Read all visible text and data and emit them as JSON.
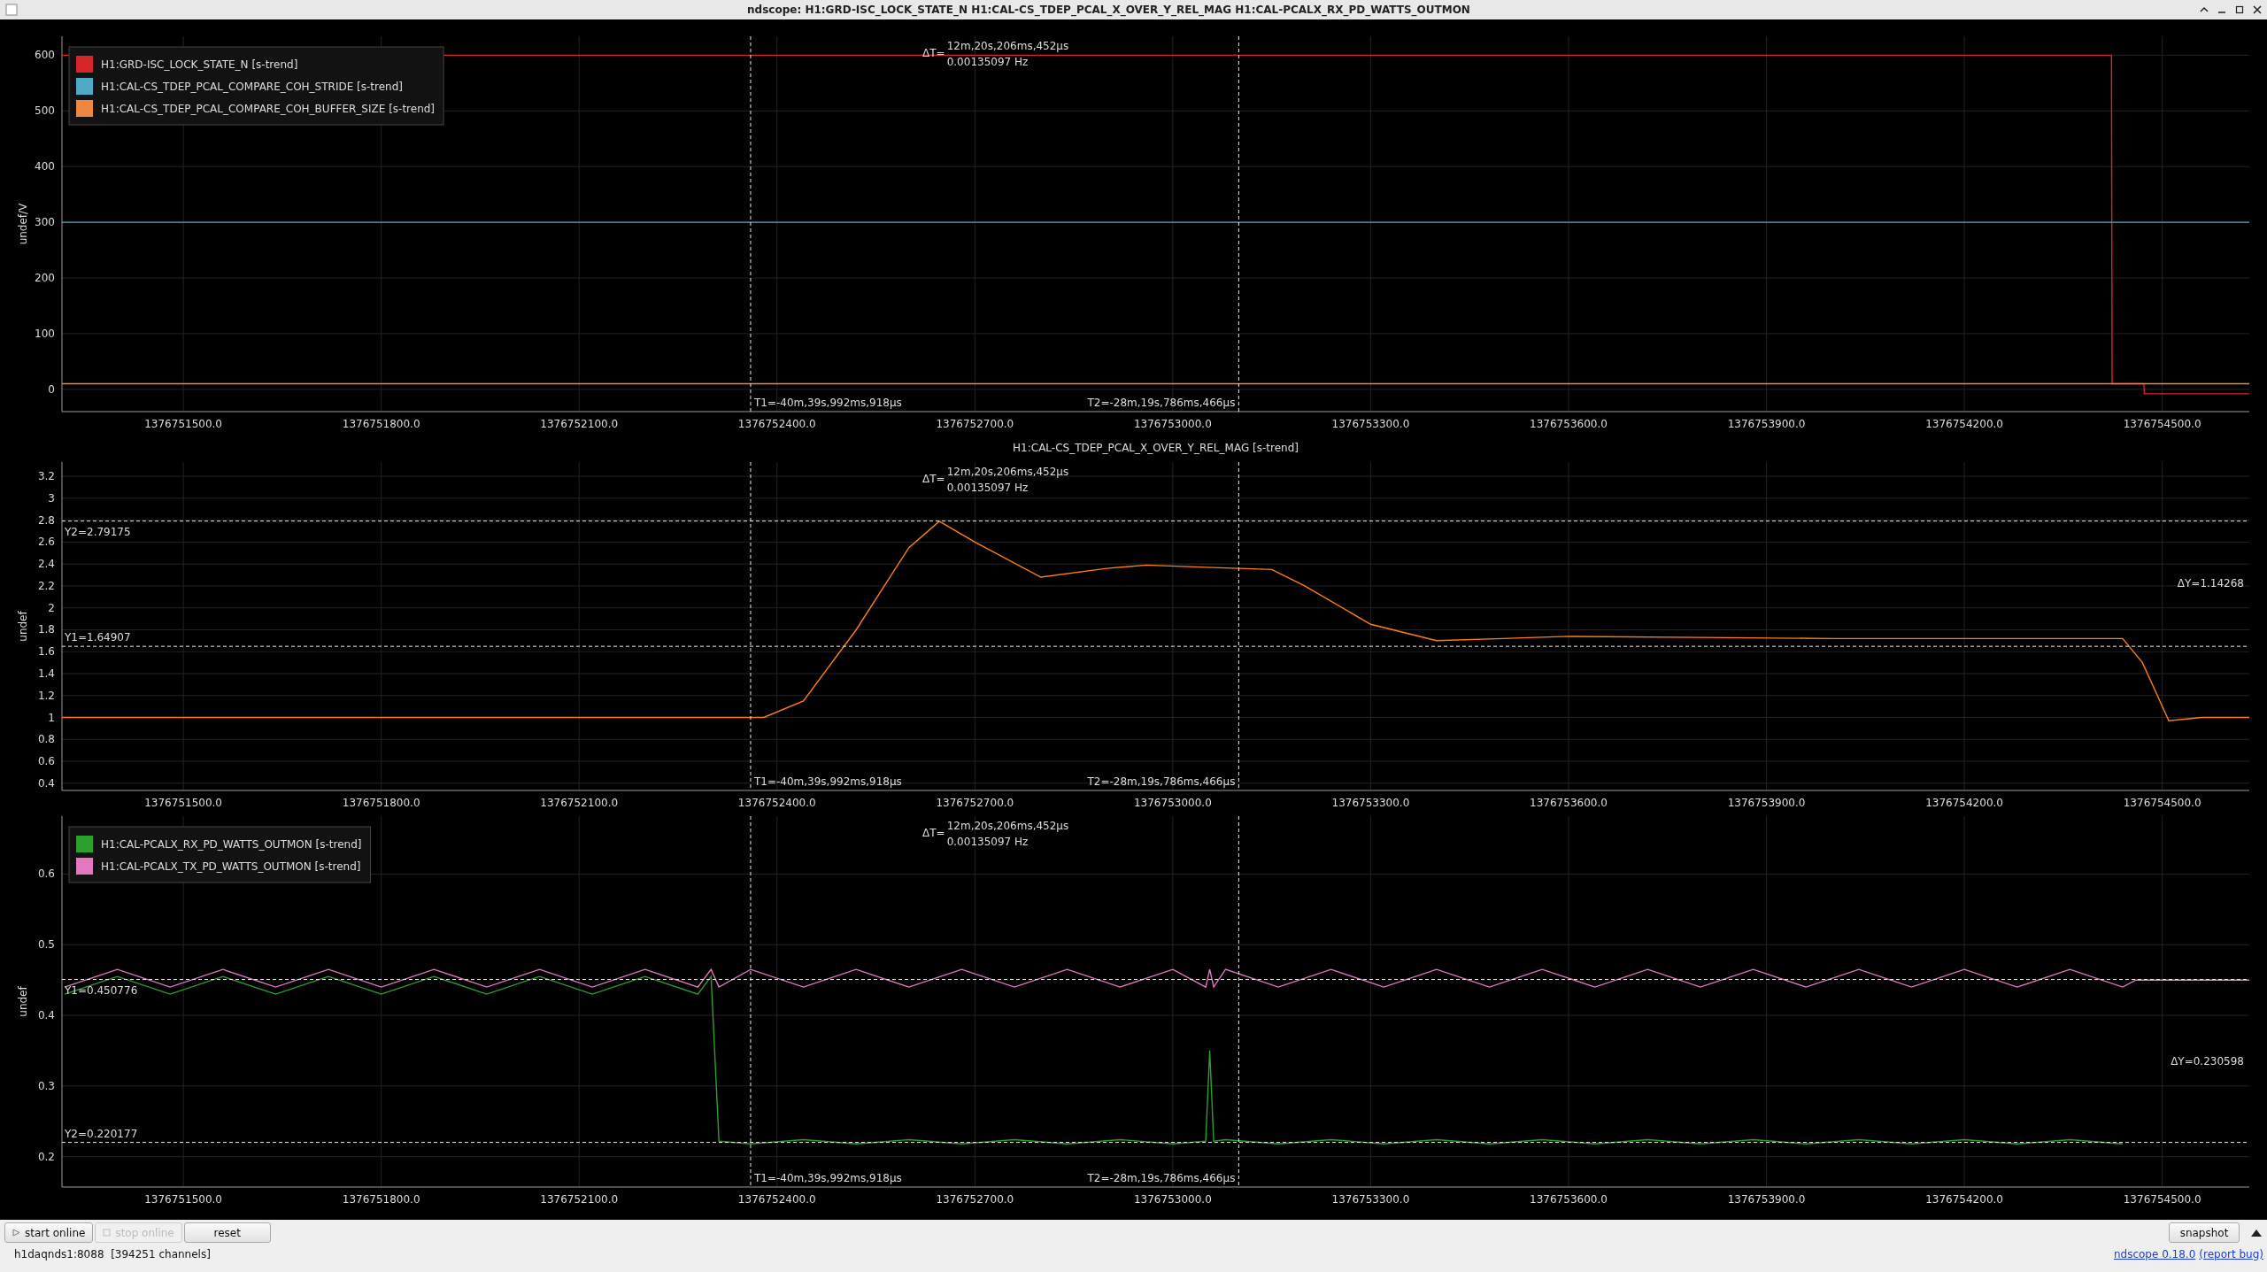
{
  "window": {
    "title": "ndscope: H1:GRD-ISC_LOCK_STATE_N H1:CAL-CS_TDEP_PCAL_X_OVER_Y_REL_MAG H1:CAL-PCALX_RX_PD_WATTS_OUTMON"
  },
  "plots": [
    {
      "cursors": {
        "x_labels": [
          "T1=-40m,39s,992ms,918μs",
          "T2=-28m,19s,786ms,466μs"
        ],
        "delta_x": {
          "label": "ΔT=",
          "value": "12m,20s,206ms,452μs",
          "freq": "0.00135097 Hz"
        }
      },
      "chart_data": {
        "type": "line",
        "ylabel": "undef/V",
        "legend": "upper left",
        "grid": true,
        "x": [
          1376751316,
          1376754423,
          1376754424,
          1376754472,
          1376754473,
          1376754632
        ],
        "series": [
          {
            "name": "H1:GRD-ISC_LOCK_STATE_N [s-trend]",
            "color": "#d62728",
            "values": [
              600,
              600,
              10,
              10,
              -8,
              -8
            ]
          },
          {
            "name": "H1:CAL-CS_TDEP_PCAL_COMPARE_COH_STRIDE [s-trend]",
            "color": "#4fa8c5",
            "values": [
              300,
              300,
              300,
              300,
              300,
              300
            ]
          },
          {
            "name": "H1:CAL-CS_TDEP_PCAL_COMPARE_COH_BUFFER_SIZE [s-trend]",
            "color": "#ef8741",
            "values": [
              10,
              10,
              10,
              10,
              10,
              10
            ]
          }
        ],
        "xlim": [
          1376751316,
          1376754632
        ],
        "ylim": [
          -40,
          634
        ],
        "xticks": [
          {
            "value": 1376751500,
            "label": "1376751500.0"
          },
          {
            "value": 1376751800,
            "label": "1376751800.0"
          },
          {
            "value": 1376752100,
            "label": "1376752100.0"
          },
          {
            "value": 1376752400,
            "label": "1376752400.0"
          },
          {
            "value": 1376752700,
            "label": "1376752700.0"
          },
          {
            "value": 1376753000,
            "label": "1376753000.0"
          },
          {
            "value": 1376753300,
            "label": "1376753300.0"
          },
          {
            "value": 1376753600,
            "label": "1376753600.0"
          },
          {
            "value": 1376753900,
            "label": "1376753900.0"
          },
          {
            "value": 1376754200,
            "label": "1376754200.0"
          },
          {
            "value": 1376754500,
            "label": "1376754500.0"
          }
        ],
        "yticks": [
          0,
          100,
          200,
          300,
          400,
          500,
          600
        ],
        "ref_lines": [
          {
            "axis": "x",
            "value": 1376752360
          },
          {
            "axis": "x",
            "value": 1376753100
          }
        ]
      }
    },
    {
      "cursors": {
        "x_labels": [
          "T1=-40m,39s,992ms,918μs",
          "T2=-28m,19s,786ms,466μs"
        ],
        "delta_x": {
          "label": "ΔT=",
          "value": "12m,20s,206ms,452μs",
          "freq": "0.00135097 Hz"
        },
        "y_labels": [
          "Y2=2.79175",
          "Y1=1.64907"
        ],
        "delta_y": "ΔY=1.14268"
      },
      "chart_data": {
        "type": "line",
        "ylabel": "undef",
        "grid": true,
        "x": [
          1376751316,
          1376752380,
          1376752440,
          1376752520,
          1376752600,
          1376752646,
          1376752700,
          1376752800,
          1376752900,
          1376752960,
          1376753050,
          1376753150,
          1376753200,
          1376753300,
          1376753400,
          1376753500,
          1376753600,
          1376753800,
          1376754000,
          1376754440,
          1376754470,
          1376754510,
          1376754560,
          1376754632
        ],
        "series": [
          {
            "name": "H1:CAL-CS_TDEP_PCAL_X_OVER_Y_REL_MAG [s-trend]",
            "color": "#ff7f0e",
            "values": [
              1,
              1,
              1.15,
              1.8,
              2.55,
              2.79,
              2.6,
              2.28,
              2.36,
              2.39,
              2.37,
              2.35,
              2.2,
              1.85,
              1.7,
              1.72,
              1.74,
              1.73,
              1.72,
              1.72,
              1.5,
              0.97,
              1.0,
              1.0
            ]
          }
        ],
        "xlim": [
          1376751316,
          1376754632
        ],
        "ylim": [
          0.334,
          3.33
        ],
        "xticks": [
          {
            "value": 1376751500,
            "label": "1376751500.0"
          },
          {
            "value": 1376751800,
            "label": "1376751800.0"
          },
          {
            "value": 1376752100,
            "label": "1376752100.0"
          },
          {
            "value": 1376752400,
            "label": "1376752400.0"
          },
          {
            "value": 1376752700,
            "label": "1376752700.0"
          },
          {
            "value": 1376753000,
            "label": "1376753000.0"
          },
          {
            "value": 1376753300,
            "label": "1376753300.0"
          },
          {
            "value": 1376753600,
            "label": "1376753600.0"
          },
          {
            "value": 1376753900,
            "label": "1376753900.0"
          },
          {
            "value": 1376754200,
            "label": "1376754200.0"
          },
          {
            "value": 1376754500,
            "label": "1376754500.0"
          }
        ],
        "yticks": [
          0.4,
          0.6,
          0.8,
          1,
          1.2,
          1.4,
          1.6,
          1.8,
          2,
          2.2,
          2.4,
          2.6,
          2.8,
          3,
          3.2
        ],
        "ref_lines": [
          {
            "axis": "x",
            "value": 1376752360
          },
          {
            "axis": "x",
            "value": 1376753100
          },
          {
            "axis": "y",
            "value": 2.79175
          },
          {
            "axis": "y",
            "value": 1.64907
          }
        ]
      }
    },
    {
      "cursors": {
        "x_labels": [
          "T1=-40m,39s,992ms,918μs",
          "T2=-28m,19s,786ms,466μs"
        ],
        "delta_x": {
          "label": "ΔT=",
          "value": "12m,20s,206ms,452μs",
          "freq": "0.00135097 Hz"
        },
        "y_labels": [
          "Y1=0.450776",
          "Y2=0.220177"
        ],
        "delta_y": "ΔY=0.230598"
      },
      "chart_data": {
        "type": "line",
        "ylabel": "undef",
        "legend": "upper left",
        "grid": true,
        "x": [
          1376751320,
          1376751400,
          1376751480,
          1376751560,
          1376751640,
          1376751720,
          1376751800,
          1376751880,
          1376751960,
          1376752040,
          1376752120,
          1376752200,
          1376752280,
          1376752300,
          1376752312,
          1376752360,
          1376752440,
          1376752520,
          1376752600,
          1376752680,
          1376752760,
          1376752840,
          1376752920,
          1376753000,
          1376753050,
          1376753056,
          1376753062,
          1376753080,
          1376753160,
          1376753240,
          1376753320,
          1376753400,
          1376753480,
          1376753560,
          1376753640,
          1376753720,
          1376753800,
          1376753880,
          1376753960,
          1376754040,
          1376754120,
          1376754200,
          1376754280,
          1376754360,
          1376754440,
          1376754460,
          1376754632
        ],
        "series": [
          {
            "name": "H1:CAL-PCALX_RX_PD_WATTS_OUTMON [s-trend]",
            "color": "#2ca02c",
            "values": [
              0.43,
              0.455,
              0.43,
              0.455,
              0.43,
              0.455,
              0.43,
              0.455,
              0.43,
              0.455,
              0.43,
              0.455,
              0.43,
              0.455,
              0.222,
              0.218,
              0.224,
              0.218,
              0.224,
              0.218,
              0.224,
              0.218,
              0.224,
              0.218,
              0.222,
              0.35,
              0.222,
              0.224,
              0.218,
              0.224,
              0.218,
              0.224,
              0.218,
              0.224,
              0.218,
              0.224,
              0.218,
              0.224,
              0.218,
              0.224,
              0.218,
              0.224,
              0.218,
              0.224,
              0.218,
              null,
              null
            ]
          },
          {
            "name": "H1:CAL-PCALX_TX_PD_WATTS_OUTMON [s-trend]",
            "color": "#e377c2",
            "values": [
              0.44,
              0.465,
              0.44,
              0.465,
              0.44,
              0.465,
              0.44,
              0.465,
              0.44,
              0.465,
              0.44,
              0.465,
              0.44,
              0.465,
              0.44,
              0.465,
              0.44,
              0.465,
              0.44,
              0.465,
              0.44,
              0.465,
              0.44,
              0.465,
              0.44,
              0.465,
              0.44,
              0.465,
              0.44,
              0.465,
              0.44,
              0.465,
              0.44,
              0.465,
              0.44,
              0.465,
              0.44,
              0.465,
              0.44,
              0.465,
              0.44,
              0.465,
              0.44,
              0.465,
              0.44,
              0.45,
              0.45
            ]
          }
        ],
        "xlim": [
          1376751316,
          1376754632
        ],
        "ylim": [
          0.157,
          0.682
        ],
        "xticks": [
          {
            "value": 1376751500,
            "label": "1376751500.0"
          },
          {
            "value": 1376751800,
            "label": "1376751800.0"
          },
          {
            "value": 1376752100,
            "label": "1376752100.0"
          },
          {
            "value": 1376752400,
            "label": "1376752400.0"
          },
          {
            "value": 1376752700,
            "label": "1376752700.0"
          },
          {
            "value": 1376753000,
            "label": "1376753000.0"
          },
          {
            "value": 1376753300,
            "label": "1376753300.0"
          },
          {
            "value": 1376753600,
            "label": "1376753600.0"
          },
          {
            "value": 1376753900,
            "label": "1376753900.0"
          },
          {
            "value": 1376754200,
            "label": "1376754200.0"
          },
          {
            "value": 1376754500,
            "label": "1376754500.0"
          }
        ],
        "yticks": [
          0.2,
          0.3,
          0.4,
          0.5,
          0.6
        ],
        "ref_lines": [
          {
            "axis": "x",
            "value": 1376752360
          },
          {
            "axis": "x",
            "value": 1376753100
          },
          {
            "axis": "y",
            "value": 0.450776
          },
          {
            "axis": "y",
            "value": 0.220177
          }
        ]
      }
    }
  ],
  "toolbar": {
    "buttons": [
      {
        "label": "start online",
        "kind": "play",
        "disabled": false
      },
      {
        "label": "stop online",
        "kind": "stop",
        "disabled": true
      },
      {
        "label": "reset",
        "kind": "plain",
        "disabled": false
      }
    ],
    "snapshot": "snapshot"
  },
  "status_bar": {
    "server": "h1daqnds1:8088  [394251 channels]",
    "version_link": "ndscope 0.18.0",
    "report_link": "(report bug)"
  }
}
